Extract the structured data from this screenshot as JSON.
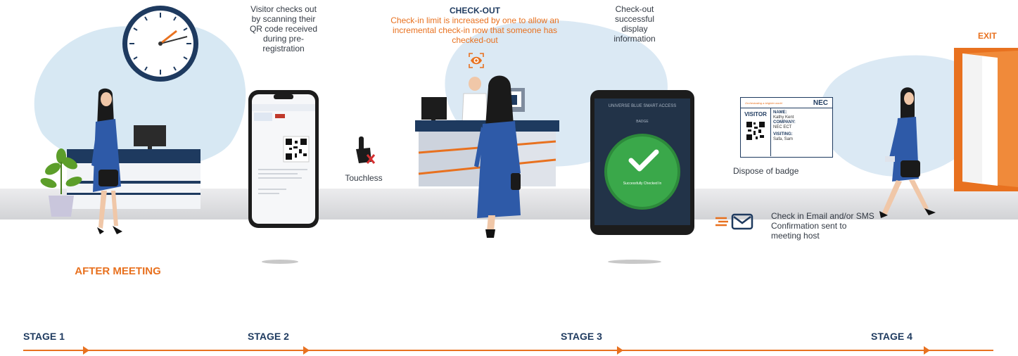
{
  "intro": {
    "label": "AFTER MEETING"
  },
  "steps": {
    "scan_text": "Visitor checks out by scanning their QR code received during pre-registration",
    "checkout_title": "CHECK-OUT",
    "checkout_text": "Check-in limit is increased by one to allow an incremental check-in now that someone has checked-out",
    "touchless": "Touchless",
    "success_text": "Check-out successful display information",
    "dispose": "Dispose of  badge",
    "email_text": "Check in Email and/or SMS Confirmation sent to meeting host",
    "exit": "EXIT"
  },
  "tablet": {
    "header": "UNIVERSE BLUE SMART ACCESS",
    "subheader": "BADGE",
    "status": "Successfully Checked In"
  },
  "badge": {
    "tagline": "Orchestrating a brighter world",
    "brand": "NEC",
    "visitor_label": "VISITOR",
    "name_label": "NAME:",
    "name_value": "Kathy Kent",
    "company_label": "COMPANY:",
    "company_value": "NEC ECT",
    "visiting_label": "VISITING:",
    "visiting_value": "Safa, Sam"
  },
  "stages": [
    {
      "label": "STAGE 1"
    },
    {
      "label": "STAGE 2"
    },
    {
      "label": "STAGE 3"
    },
    {
      "label": "STAGE 4"
    }
  ],
  "colors": {
    "accent": "#e8711f",
    "navy": "#1e3a5f",
    "floor": "#e4e4e6",
    "blob": "#d7e8f3",
    "success": "#3aa84a"
  },
  "icons": [
    "clock-icon",
    "plant-icon",
    "phone-icon",
    "touchless-icon",
    "eye-scan-icon",
    "tablet-icon",
    "checkmark-icon",
    "badge-icon",
    "email-icon",
    "exit-door-icon"
  ]
}
